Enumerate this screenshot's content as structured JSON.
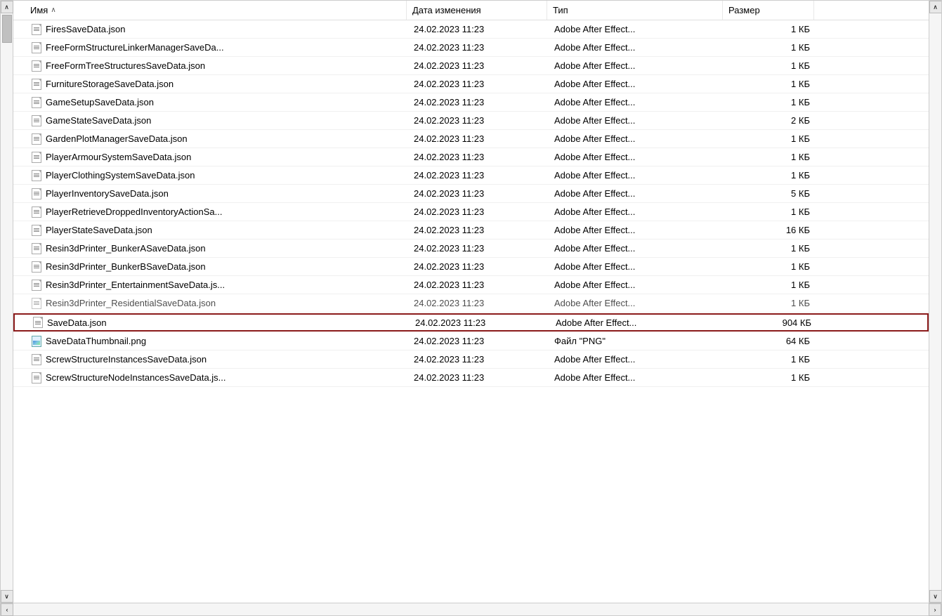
{
  "columns": {
    "name": "Имя",
    "date": "Дата изменения",
    "type": "Тип",
    "size": "Размер"
  },
  "sort_arrow": "∧",
  "files": [
    {
      "id": 1,
      "name": "FiresSaveData.json",
      "date": "24.02.2023 11:23",
      "type": "Adobe After Effect...",
      "size": "1 КБ",
      "icon": "json",
      "highlighted": false,
      "cutoff": false
    },
    {
      "id": 2,
      "name": "FreeFormStructureLinkerManagerSaveDa...",
      "date": "24.02.2023 11:23",
      "type": "Adobe After Effect...",
      "size": "1 КБ",
      "icon": "json",
      "highlighted": false,
      "cutoff": false
    },
    {
      "id": 3,
      "name": "FreeFormTreeStructuresSaveData.json",
      "date": "24.02.2023 11:23",
      "type": "Adobe After Effect...",
      "size": "1 КБ",
      "icon": "json",
      "highlighted": false,
      "cutoff": false
    },
    {
      "id": 4,
      "name": "FurnitureStorageSaveData.json",
      "date": "24.02.2023 11:23",
      "type": "Adobe After Effect...",
      "size": "1 КБ",
      "icon": "json",
      "highlighted": false,
      "cutoff": false
    },
    {
      "id": 5,
      "name": "GameSetupSaveData.json",
      "date": "24.02.2023 11:23",
      "type": "Adobe After Effect...",
      "size": "1 КБ",
      "icon": "json",
      "highlighted": false,
      "cutoff": false
    },
    {
      "id": 6,
      "name": "GameStateSaveData.json",
      "date": "24.02.2023 11:23",
      "type": "Adobe After Effect...",
      "size": "2 КБ",
      "icon": "json",
      "highlighted": false,
      "cutoff": false
    },
    {
      "id": 7,
      "name": "GardenPlotManagerSaveData.json",
      "date": "24.02.2023 11:23",
      "type": "Adobe After Effect...",
      "size": "1 КБ",
      "icon": "json",
      "highlighted": false,
      "cutoff": false
    },
    {
      "id": 8,
      "name": "PlayerArmourSystemSaveData.json",
      "date": "24.02.2023 11:23",
      "type": "Adobe After Effect...",
      "size": "1 КБ",
      "icon": "json",
      "highlighted": false,
      "cutoff": false
    },
    {
      "id": 9,
      "name": "PlayerClothingSystemSaveData.json",
      "date": "24.02.2023 11:23",
      "type": "Adobe After Effect...",
      "size": "1 КБ",
      "icon": "json",
      "highlighted": false,
      "cutoff": false
    },
    {
      "id": 10,
      "name": "PlayerInventorySaveData.json",
      "date": "24.02.2023 11:23",
      "type": "Adobe After Effect...",
      "size": "5 КБ",
      "icon": "json",
      "highlighted": false,
      "cutoff": false
    },
    {
      "id": 11,
      "name": "PlayerRetrieveDroppedInventoryActionSa...",
      "date": "24.02.2023 11:23",
      "type": "Adobe After Effect...",
      "size": "1 КБ",
      "icon": "json",
      "highlighted": false,
      "cutoff": false
    },
    {
      "id": 12,
      "name": "PlayerStateSaveData.json",
      "date": "24.02.2023 11:23",
      "type": "Adobe After Effect...",
      "size": "16 КБ",
      "icon": "json",
      "highlighted": false,
      "cutoff": false
    },
    {
      "id": 13,
      "name": "Resin3dPrinter_BunkerASaveData.json",
      "date": "24.02.2023 11:23",
      "type": "Adobe After Effect...",
      "size": "1 КБ",
      "icon": "json",
      "highlighted": false,
      "cutoff": false
    },
    {
      "id": 14,
      "name": "Resin3dPrinter_BunkerBSaveData.json",
      "date": "24.02.2023 11:23",
      "type": "Adobe After Effect...",
      "size": "1 КБ",
      "icon": "json",
      "highlighted": false,
      "cutoff": false
    },
    {
      "id": 15,
      "name": "Resin3dPrinter_EntertainmentSaveData.js...",
      "date": "24.02.2023 11:23",
      "type": "Adobe After Effect...",
      "size": "1 КБ",
      "icon": "json",
      "highlighted": false,
      "cutoff": false
    },
    {
      "id": 16,
      "name": "Resin3dPrinter_ResidentialSaveData.json",
      "date": "24.02.2023 11:23",
      "type": "Adobe After Effect...",
      "size": "1 КБ",
      "icon": "json",
      "highlighted": false,
      "cutoff": true
    },
    {
      "id": 17,
      "name": "SaveData.json",
      "date": "24.02.2023 11:23",
      "type": "Adobe After Effect...",
      "size": "904 КБ",
      "icon": "json",
      "highlighted": true,
      "cutoff": false
    },
    {
      "id": 18,
      "name": "SaveDataThumbnail.png",
      "date": "24.02.2023 11:23",
      "type": "Файл \"PNG\"",
      "size": "64 КБ",
      "icon": "png",
      "highlighted": false,
      "cutoff": false
    },
    {
      "id": 19,
      "name": "ScrewStructureInstancesSaveData.json",
      "date": "24.02.2023 11:23",
      "type": "Adobe After Effect...",
      "size": "1 КБ",
      "icon": "json",
      "highlighted": false,
      "cutoff": false
    },
    {
      "id": 20,
      "name": "ScrewStructureNodeInstancesSaveData.js...",
      "date": "24.02.2023 11:23",
      "type": "Adobe After Effect...",
      "size": "1 КБ",
      "icon": "json",
      "highlighted": false,
      "cutoff": false
    }
  ],
  "scroll": {
    "up_arrow": "∧",
    "down_arrow": "∨",
    "left_arrow": "‹",
    "right_arrow": "›"
  }
}
